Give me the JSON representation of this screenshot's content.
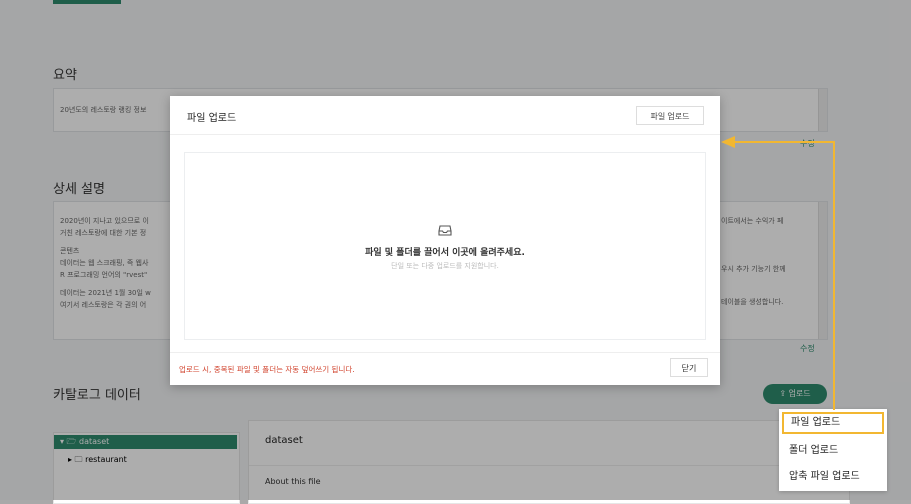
{
  "background": {
    "summary_title": "요약",
    "summary_text": "20년도의 레스토랑 랭킹 정보",
    "detail_title": "상세 설명",
    "detail_lines_left": [
      "2020년이 지나고 있으므로 이",
      "거친 레스토랑에 대한 기본 정",
      "콘텐츠",
      "데이터는 웹 스크래핑, 즉 웹사",
      "R 프로그래밍 언어의 \"rvest\"",
      "데이터는 2021년 1월 30일 w",
      "여기서 레스토랑은 각 권의 어"
    ],
    "detail_lines_right": [
      "이트에서는 수익가 페",
      "우시 추가 기능기 한께",
      "테이블을 생성합니다."
    ],
    "edit_label_1": "수정",
    "edit_label_2": "수정",
    "catalog_title": "카탈로그 데이터",
    "upload_button": "⇪ 업로드",
    "tree": [
      {
        "label": "▾  🗁 dataset"
      },
      {
        "label": "▸  🗀 restaurant"
      }
    ],
    "detail_name": "dataset",
    "about_label": "About this file"
  },
  "modal": {
    "title": "파일 업로드",
    "header_button": "파일 업로드",
    "drop_main": "파일 및 폴더를 끌어서 이곳에 올려주세요.",
    "drop_sub": "단일 또는 다중 업로드를 지원합니다.",
    "note": "업로드 시, 중복된 파일 및 폴더는 자동 덮어쓰기 됩니다.",
    "close_button": "닫기"
  },
  "dropdown": {
    "items": [
      "파일 업로드",
      "폴더 업로드",
      "압축 파일 업로드"
    ],
    "highlighted_index": 0
  },
  "colors": {
    "accent": "#2e8b6e",
    "annotation": "#f2b731",
    "warning": "#d2452f"
  },
  "icons": {
    "drop": "inbox-icon"
  }
}
